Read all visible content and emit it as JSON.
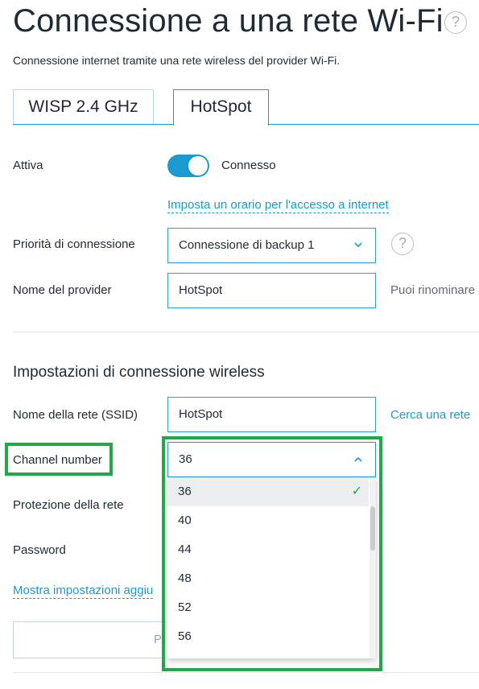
{
  "page": {
    "title": "Connessione a una rete Wi-Fi",
    "subtitle": "Connessione internet tramite una rete wireless del provider Wi-Fi.",
    "help_icon": "question-circle-icon"
  },
  "tabs": [
    {
      "label": "WISP 2.4 GHz",
      "active": false
    },
    {
      "label": "HotSpot",
      "active": true
    }
  ],
  "form": {
    "active_label": "Attiva",
    "active_state": "Connesso",
    "schedule_link": "Imposta un orario per l'accesso a internet",
    "priority_label": "Priorità di connessione",
    "priority_value": "Connessione di backup 1",
    "provider_label": "Nome del provider",
    "provider_value": "HotSpot",
    "provider_hint": "Puoi rinominare"
  },
  "wireless": {
    "section_title": "Impostazioni di connessione wireless",
    "ssid_label": "Nome della rete (SSID)",
    "ssid_value": "HotSpot",
    "search_link": "Cerca una rete",
    "channel_label": "Channel number",
    "channel_value": "36",
    "channel_options": [
      "36",
      "40",
      "44",
      "48",
      "52",
      "56"
    ],
    "protection_label": "Protezione della rete",
    "password_label": "Password",
    "advanced_link": "Mostra impostazioni aggiu"
  },
  "bottom": {
    "button_text": "P"
  },
  "colors": {
    "accent": "#1b9ad0",
    "highlight": "#22a84a",
    "text": "#1f2a33"
  }
}
